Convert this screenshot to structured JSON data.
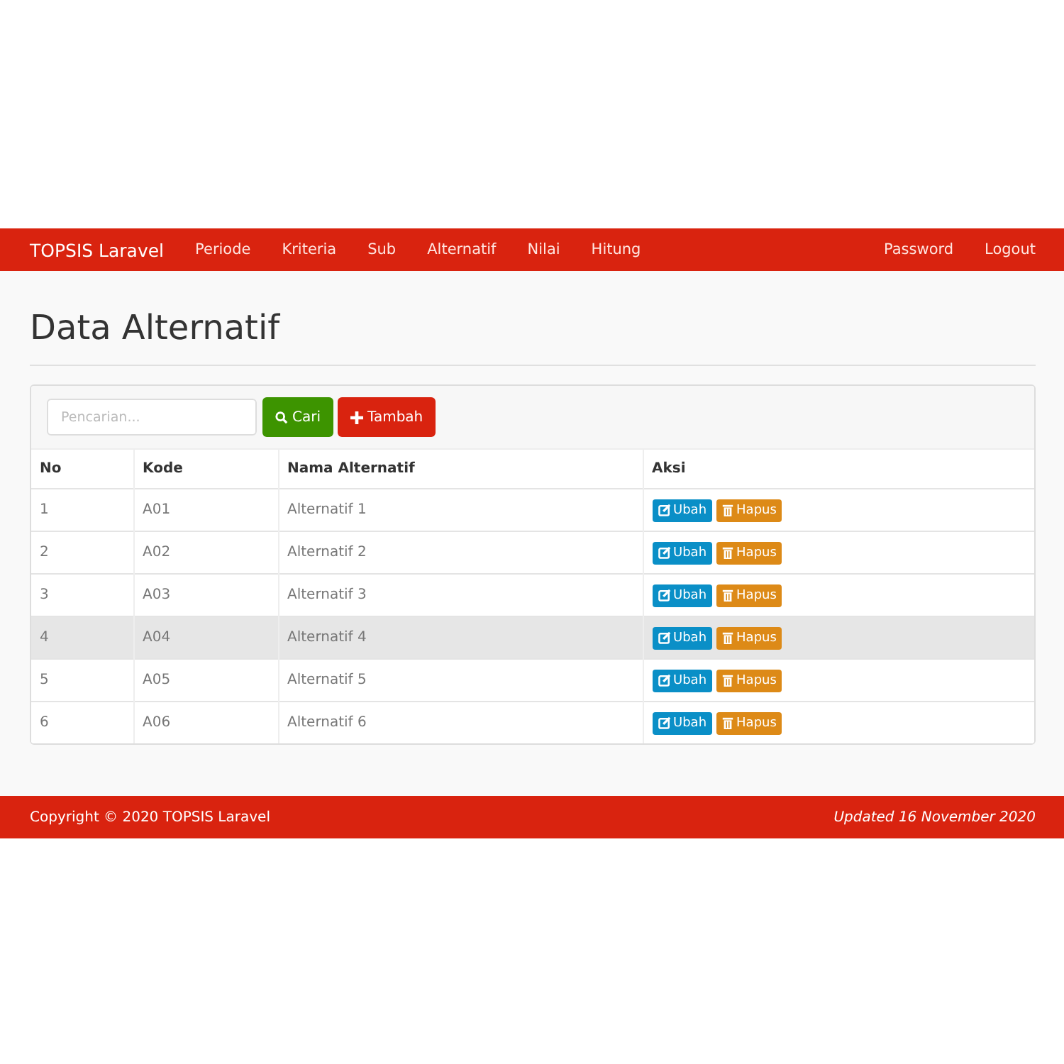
{
  "navbar": {
    "brand": "TOPSIS Laravel",
    "items": [
      "Periode",
      "Kriteria",
      "Sub",
      "Alternatif",
      "Nilai",
      "Hitung"
    ],
    "right_items": [
      "Password",
      "Logout"
    ]
  },
  "page_title": "Data Alternatif",
  "toolbar": {
    "search": {
      "placeholder": "Pencarian..."
    },
    "search_button": "Cari",
    "add_button": "Tambah"
  },
  "table": {
    "columns": [
      "No",
      "Kode",
      "Nama Alternatif",
      "Aksi"
    ],
    "rows": [
      {
        "cells": [
          "1",
          "A01",
          "Alternatif 1"
        ],
        "highlighted": false,
        "actions": [
          "Ubah",
          "Hapus"
        ]
      },
      {
        "cells": [
          "2",
          "A02",
          "Alternatif 2"
        ],
        "highlighted": false,
        "actions": [
          "Ubah",
          "Hapus"
        ]
      },
      {
        "cells": [
          "3",
          "A03",
          "Alternatif 3"
        ],
        "highlighted": false,
        "actions": [
          "Ubah",
          "Hapus"
        ]
      },
      {
        "cells": [
          "4",
          "A04",
          "Alternatif 4"
        ],
        "highlighted": true,
        "actions": [
          "Ubah",
          "Hapus"
        ]
      },
      {
        "cells": [
          "5",
          "A05",
          "Alternatif 5"
        ],
        "highlighted": false,
        "actions": [
          "Ubah",
          "Hapus"
        ]
      },
      {
        "cells": [
          "6",
          "A06",
          "Alternatif 6"
        ],
        "highlighted": false,
        "actions": [
          "Ubah",
          "Hapus"
        ]
      }
    ]
  },
  "footer": {
    "copyright": "Copyright © 2020 TOPSIS Laravel",
    "updated": "Updated 16 November 2020"
  }
}
